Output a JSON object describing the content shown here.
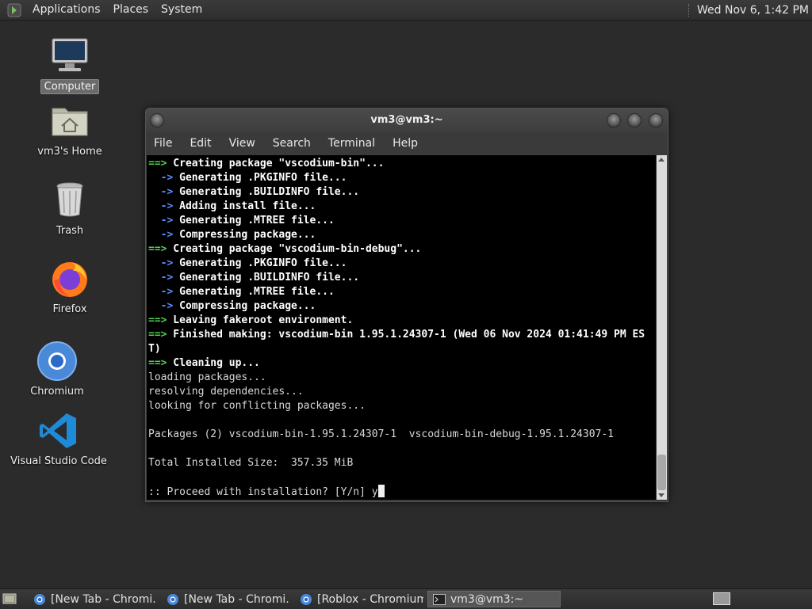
{
  "top_panel": {
    "menu_applications": "Applications",
    "menu_places": "Places",
    "menu_system": "System",
    "clock": "Wed Nov 6, 1:42 PM"
  },
  "desktop_icons": {
    "computer": "Computer",
    "home": "vm3's Home",
    "trash": "Trash",
    "firefox": "Firefox",
    "chromium": "Chromium",
    "vscode": "Visual Studio Code"
  },
  "terminal": {
    "title": "vm3@vm3:~",
    "menu": [
      "File",
      "Edit",
      "View",
      "Search",
      "Terminal",
      "Help"
    ],
    "lines": [
      {
        "prefix": "==>",
        "style": "g",
        "text": " Creating package \"vscodium-bin\"..."
      },
      {
        "prefix": "  ->",
        "style": "b",
        "text": " Generating .PKGINFO file..."
      },
      {
        "prefix": "  ->",
        "style": "b",
        "text": " Generating .BUILDINFO file..."
      },
      {
        "prefix": "  ->",
        "style": "b",
        "text": " Adding install file..."
      },
      {
        "prefix": "  ->",
        "style": "b",
        "text": " Generating .MTREE file..."
      },
      {
        "prefix": "  ->",
        "style": "b",
        "text": " Compressing package..."
      },
      {
        "prefix": "==>",
        "style": "g",
        "text": " Creating package \"vscodium-bin-debug\"..."
      },
      {
        "prefix": "  ->",
        "style": "b",
        "text": " Generating .PKGINFO file..."
      },
      {
        "prefix": "  ->",
        "style": "b",
        "text": " Generating .BUILDINFO file..."
      },
      {
        "prefix": "  ->",
        "style": "b",
        "text": " Generating .MTREE file..."
      },
      {
        "prefix": "  ->",
        "style": "b",
        "text": " Compressing package..."
      },
      {
        "prefix": "==>",
        "style": "g",
        "text": " Leaving fakeroot environment."
      },
      {
        "prefix": "==>",
        "style": "g",
        "text": " Finished making: vscodium-bin 1.95.1.24307-1 (Wed 06 Nov 2024 01:41:49 PM ES"
      },
      {
        "prefix": "",
        "style": "w",
        "text": "T)"
      },
      {
        "prefix": "==>",
        "style": "g",
        "text": " Cleaning up..."
      },
      {
        "prefix": "",
        "style": "",
        "text": "loading packages..."
      },
      {
        "prefix": "",
        "style": "",
        "text": "resolving dependencies..."
      },
      {
        "prefix": "",
        "style": "",
        "text": "looking for conflicting packages..."
      },
      {
        "prefix": "",
        "style": "",
        "text": ""
      },
      {
        "prefix": "",
        "style": "",
        "text": "Packages (2) vscodium-bin-1.95.1.24307-1  vscodium-bin-debug-1.95.1.24307-1"
      },
      {
        "prefix": "",
        "style": "",
        "text": ""
      },
      {
        "prefix": "",
        "style": "",
        "text": "Total Installed Size:  357.35 MiB"
      },
      {
        "prefix": "",
        "style": "",
        "text": ""
      }
    ],
    "prompt": ":: Proceed with installation? [Y/n] ",
    "input": "y"
  },
  "taskbar": {
    "tasks": [
      {
        "label": "[New Tab - Chromi...",
        "icon": "chromium-icon"
      },
      {
        "label": "[New Tab - Chromi...",
        "icon": "chromium-icon"
      },
      {
        "label": "[Roblox - Chromium]",
        "icon": "chromium-icon"
      },
      {
        "label": "vm3@vm3:~",
        "icon": "terminal-icon"
      }
    ]
  },
  "colors": {
    "desktop": "#2b2b2b",
    "terminal_bg": "#000000",
    "arrow_green": "#4fd04f",
    "arrow_blue": "#5a8cff"
  }
}
